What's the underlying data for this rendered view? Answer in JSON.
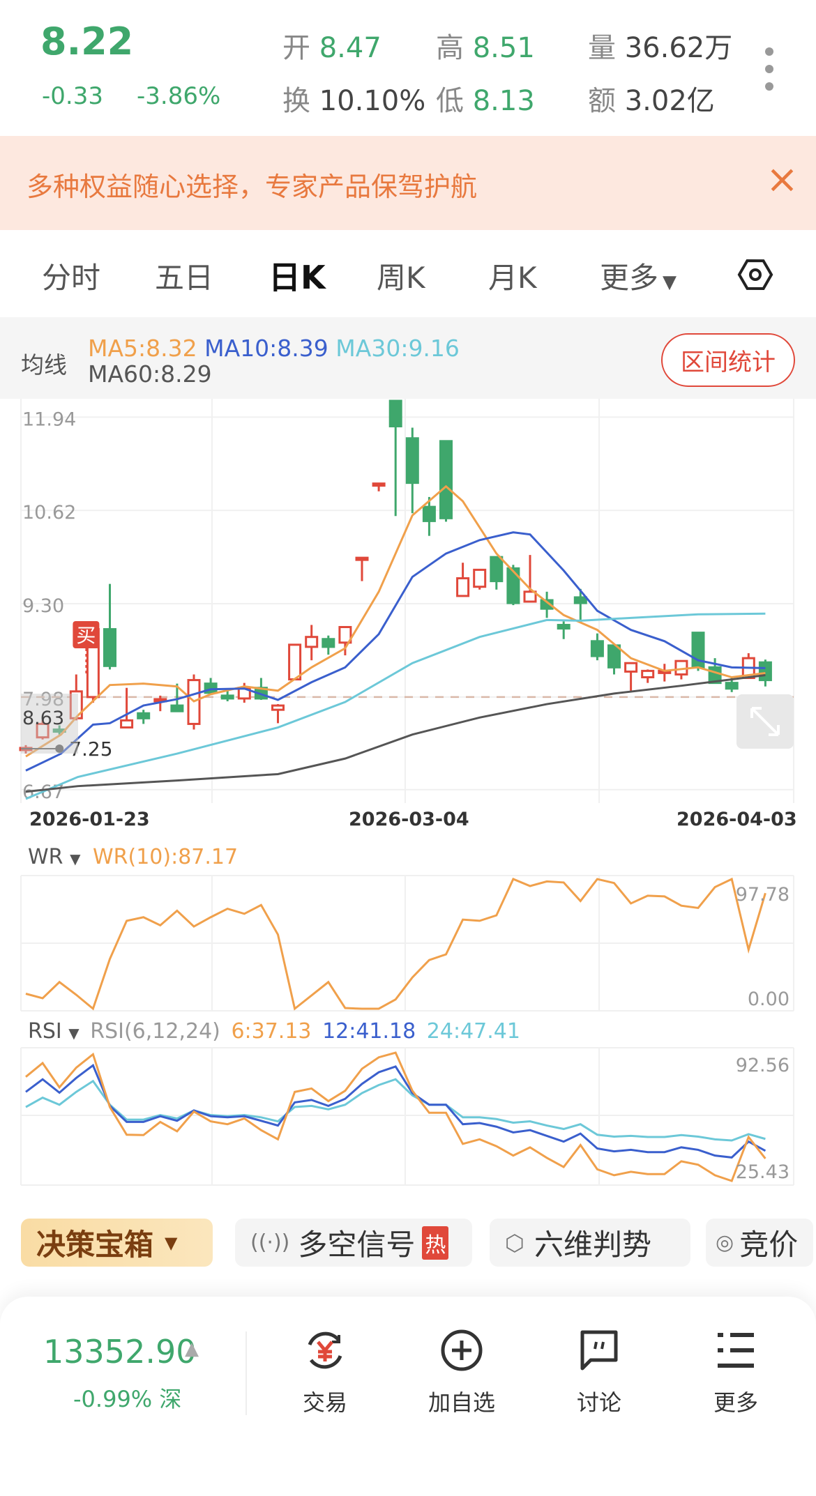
{
  "quote": {
    "price": "8.22",
    "change": "-0.33",
    "change_pct": "-3.86%",
    "open_label": "开",
    "open": "8.47",
    "high_label": "高",
    "high": "8.51",
    "volume_label": "量",
    "volume": "36.62万",
    "turnover_label": "换",
    "turnover": "10.10%",
    "low_label": "低",
    "low": "8.13",
    "amount_label": "额",
    "amount": "3.02亿"
  },
  "banner": {
    "text": "多种权益随心选择，专家产品保驾护航",
    "close": "×"
  },
  "tabs": [
    {
      "label": "分时"
    },
    {
      "label": "五日"
    },
    {
      "label": "日K",
      "active": true
    },
    {
      "label": "周K"
    },
    {
      "label": "月K"
    },
    {
      "label": "更多"
    }
  ],
  "ma_bar": {
    "title": "均线",
    "ma5": "MA5:8.32",
    "ma10": "MA10:8.39",
    "ma30": "MA30:9.16",
    "ma60": "MA60:8.29",
    "stats_button": "区间统计"
  },
  "colors": {
    "up": "#e0483a",
    "down": "#3fa76c",
    "ma5": "#f0a04b",
    "ma10": "#3a5fcd",
    "ma30": "#6cc8d8",
    "ma60": "#555555"
  },
  "chart_data": [
    {
      "type": "candlestick",
      "title": "日K",
      "y_ticks": [
        "11.94",
        "10.62",
        "9.30",
        "7.98",
        "6.67"
      ],
      "ylim": [
        6.5,
        12.17
      ],
      "x_labels": [
        "2026-01-23",
        "2026-03-04",
        "2026-04-03"
      ],
      "reference_line": 7.98,
      "buy_marker": {
        "label": "买",
        "index": 4
      },
      "min_marker": {
        "label": "7.25",
        "index": 2,
        "value": 7.25
      },
      "overlay_value": "8.63",
      "candles": [
        [
          7.24,
          7.3,
          7.18,
          7.26
        ],
        [
          7.41,
          7.65,
          7.38,
          7.6
        ],
        [
          7.52,
          7.58,
          7.45,
          7.5
        ],
        [
          7.68,
          8.3,
          7.65,
          8.06
        ],
        [
          7.98,
          8.94,
          7.9,
          8.94
        ],
        [
          8.94,
          9.58,
          8.37,
          8.42
        ],
        [
          7.55,
          8.11,
          7.55,
          7.65
        ],
        [
          7.75,
          7.8,
          7.6,
          7.68
        ],
        [
          7.93,
          8.0,
          7.78,
          7.95
        ],
        [
          7.86,
          8.17,
          7.78,
          7.78
        ],
        [
          7.6,
          8.3,
          7.52,
          8.22
        ],
        [
          8.17,
          8.25,
          8.04,
          8.04
        ],
        [
          8.0,
          8.1,
          7.92,
          7.96
        ],
        [
          7.96,
          8.18,
          7.9,
          8.11
        ],
        [
          8.11,
          8.25,
          7.94,
          7.96
        ],
        [
          7.8,
          7.88,
          7.61,
          7.86
        ],
        [
          8.23,
          8.72,
          8.23,
          8.72
        ],
        [
          8.69,
          9.0,
          8.5,
          8.83
        ],
        [
          8.8,
          8.85,
          8.58,
          8.69
        ],
        [
          8.75,
          8.97,
          8.57,
          8.97
        ],
        [
          9.93,
          9.95,
          9.62,
          9.95
        ],
        [
          10.98,
          11.0,
          10.89,
          11.0
        ],
        [
          12.17,
          12.17,
          10.54,
          11.81
        ],
        [
          11.64,
          11.79,
          10.58,
          11.01
        ],
        [
          10.67,
          10.81,
          10.26,
          10.47
        ],
        [
          11.6,
          11.6,
          10.46,
          10.51
        ],
        [
          9.41,
          9.88,
          9.41,
          9.66
        ],
        [
          9.54,
          9.78,
          9.5,
          9.78
        ],
        [
          9.96,
          9.96,
          9.5,
          9.62
        ],
        [
          9.8,
          9.85,
          9.28,
          9.31
        ],
        [
          9.33,
          9.99,
          9.33,
          9.47
        ],
        [
          9.35,
          9.47,
          9.1,
          9.23
        ],
        [
          9.0,
          9.05,
          8.8,
          8.95
        ],
        [
          9.39,
          9.51,
          9.03,
          9.31
        ],
        [
          8.77,
          8.88,
          8.5,
          8.56
        ],
        [
          8.71,
          8.71,
          8.3,
          8.4
        ],
        [
          8.34,
          8.46,
          8.07,
          8.46
        ],
        [
          8.26,
          8.37,
          8.18,
          8.35
        ],
        [
          8.34,
          8.45,
          8.2,
          8.35
        ],
        [
          8.3,
          8.5,
          8.23,
          8.49
        ],
        [
          8.89,
          8.89,
          8.35,
          8.4
        ],
        [
          8.4,
          8.53,
          8.18,
          8.18
        ],
        [
          8.18,
          8.27,
          8.05,
          8.1
        ],
        [
          8.25,
          8.6,
          8.25,
          8.53
        ],
        [
          8.47,
          8.51,
          8.13,
          8.22
        ]
      ],
      "candle_fields": [
        "open",
        "high",
        "low",
        "close"
      ],
      "ma_series": [
        {
          "name": "MA5",
          "points": [
            [
              0,
              7.14
            ],
            [
              2.1,
              7.45
            ],
            [
              3.1,
              7.72
            ],
            [
              5,
              8.15
            ],
            [
              7,
              8.17
            ],
            [
              9,
              8.13
            ],
            [
              10,
              7.92
            ],
            [
              11,
              8.02
            ],
            [
              13,
              8.13
            ],
            [
              15,
              8.07
            ],
            [
              17,
              8.4
            ],
            [
              19,
              8.67
            ],
            [
              21,
              9.47
            ],
            [
              23,
              10.55
            ],
            [
              25,
              10.96
            ],
            [
              26,
              10.75
            ],
            [
              28,
              10.01
            ],
            [
              30,
              9.51
            ],
            [
              32,
              9.14
            ],
            [
              34,
              8.93
            ],
            [
              36,
              8.53
            ],
            [
              38,
              8.35
            ],
            [
              40,
              8.4
            ],
            [
              42,
              8.26
            ],
            [
              44,
              8.32
            ]
          ]
        },
        {
          "name": "MA10",
          "points": [
            [
              0,
              6.94
            ],
            [
              2.1,
              7.18
            ],
            [
              4,
              7.59
            ],
            [
              5,
              7.61
            ],
            [
              7,
              7.86
            ],
            [
              9,
              7.95
            ],
            [
              11,
              8.09
            ],
            [
              13,
              8.1
            ],
            [
              15,
              7.94
            ],
            [
              17,
              8.19
            ],
            [
              19,
              8.4
            ],
            [
              21,
              8.87
            ],
            [
              23,
              9.68
            ],
            [
              25,
              10.01
            ],
            [
              27,
              10.2
            ],
            [
              29,
              10.31
            ],
            [
              30,
              10.28
            ],
            [
              32,
              9.77
            ],
            [
              34,
              9.2
            ],
            [
              36,
              8.93
            ],
            [
              38,
              8.77
            ],
            [
              40,
              8.5
            ],
            [
              42,
              8.4
            ],
            [
              44,
              8.39
            ]
          ]
        },
        {
          "name": "MA30",
          "points": [
            [
              0,
              6.54
            ],
            [
              3.1,
              6.85
            ],
            [
              9,
              7.18
            ],
            [
              15,
              7.55
            ],
            [
              19,
              7.91
            ],
            [
              23,
              8.46
            ],
            [
              27,
              8.83
            ],
            [
              31,
              9.07
            ],
            [
              33,
              9.06
            ],
            [
              36,
              9.1
            ],
            [
              40,
              9.15
            ],
            [
              44,
              9.16
            ]
          ]
        },
        {
          "name": "MA60",
          "points": [
            [
              0,
              6.64
            ],
            [
              3.1,
              6.72
            ],
            [
              9,
              6.8
            ],
            [
              15,
              6.89
            ],
            [
              19,
              7.11
            ],
            [
              23,
              7.45
            ],
            [
              27,
              7.69
            ],
            [
              31,
              7.88
            ],
            [
              35,
              8.03
            ],
            [
              39,
              8.14
            ],
            [
              44,
              8.29
            ]
          ]
        }
      ]
    },
    {
      "type": "line",
      "title": "WR",
      "selector": "WR",
      "legend": "WR(10):87.17",
      "y_max_label": "97.78",
      "y_min_label": "0.00",
      "ylim": [
        0,
        97.78
      ],
      "series": [
        {
          "name": "WR(10)",
          "values": [
            11.3,
            7.9,
            20.1,
            10.5,
            0,
            37.5,
            66.3,
            69.0,
            62.9,
            73.9,
            62.0,
            69.0,
            75.4,
            71.6,
            78.2,
            55.9,
            0,
            10.0,
            20.1,
            0.5,
            0,
            0,
            7.0,
            23.6,
            36.7,
            41.0,
            67.2,
            66.3,
            70.4,
            97.78,
            92.5,
            96.0,
            95.2,
            81.2,
            97.78,
            94.8,
            79.4,
            85.2,
            84.7,
            77.7,
            76.0,
            91.7,
            97.78,
            44.5,
            87.17
          ]
        }
      ]
    },
    {
      "type": "line",
      "title": "RSI",
      "selector": "RSI",
      "legend": "RSI(6,12,24)",
      "y_max_label": "92.56",
      "y_min_label": "25.43",
      "ylim": [
        25.43,
        92.56
      ],
      "series": [
        {
          "name": "6",
          "label": "6:37.13",
          "values": [
            79.9,
            87.1,
            74.4,
            84.7,
            91.7,
            64.1,
            49.6,
            49.4,
            56.3,
            51.4,
            61.7,
            56.6,
            55.1,
            58.1,
            52.0,
            47.2,
            72.0,
            73.8,
            67.2,
            72.6,
            84.1,
            90.1,
            92.56,
            72.6,
            61.1,
            61.1,
            44.8,
            47.2,
            43.6,
            38.7,
            43.0,
            37.5,
            32.7,
            44.2,
            31.5,
            28.4,
            30.2,
            29.0,
            29.0,
            35.7,
            33.9,
            28.4,
            25.43,
            48.4,
            37.13
          ]
        },
        {
          "name": "12",
          "label": "12:41.18",
          "values": [
            72.0,
            78.6,
            71.6,
            79.3,
            85.9,
            64.7,
            56.3,
            56.3,
            59.3,
            56.9,
            62.3,
            59.3,
            58.7,
            59.3,
            56.9,
            54.4,
            66.5,
            67.8,
            64.7,
            68.4,
            76.2,
            82.3,
            85.3,
            71.4,
            65.3,
            65.3,
            55.1,
            55.7,
            53.8,
            50.8,
            52.0,
            49.0,
            46.0,
            50.2,
            42.4,
            40.9,
            41.7,
            40.5,
            40.5,
            43.0,
            41.7,
            38.7,
            37.7,
            46.0,
            41.18
          ]
        },
        {
          "name": "24",
          "label": "24:47.41",
          "values": [
            64.1,
            69.0,
            65.3,
            72.0,
            77.7,
            65.3,
            57.5,
            57.5,
            59.9,
            58.1,
            62.3,
            59.9,
            59.3,
            59.9,
            58.7,
            56.6,
            64.1,
            64.7,
            62.9,
            65.3,
            71.4,
            75.6,
            78.6,
            70.2,
            65.3,
            65.3,
            58.7,
            58.7,
            57.8,
            55.9,
            56.6,
            54.4,
            52.6,
            55.1,
            49.6,
            48.6,
            49.0,
            48.4,
            48.4,
            49.4,
            48.6,
            47.2,
            46.6,
            49.9,
            47.41
          ]
        }
      ]
    }
  ],
  "toolbar": {
    "decision_box": "决策宝箱",
    "signal": "多空信号",
    "hot_badge": "热",
    "six_dim": "六维判势",
    "auction": "竞价"
  },
  "bottom": {
    "index_value": "13352.90",
    "index_change": "-0.99%",
    "index_market": "深",
    "actions": [
      {
        "label": "交易",
        "icon": "trade-yen-icon"
      },
      {
        "label": "加自选",
        "icon": "add-circle-icon"
      },
      {
        "label": "讨论",
        "icon": "chat-bubble-icon"
      },
      {
        "label": "更多",
        "icon": "menu-list-icon"
      }
    ]
  }
}
